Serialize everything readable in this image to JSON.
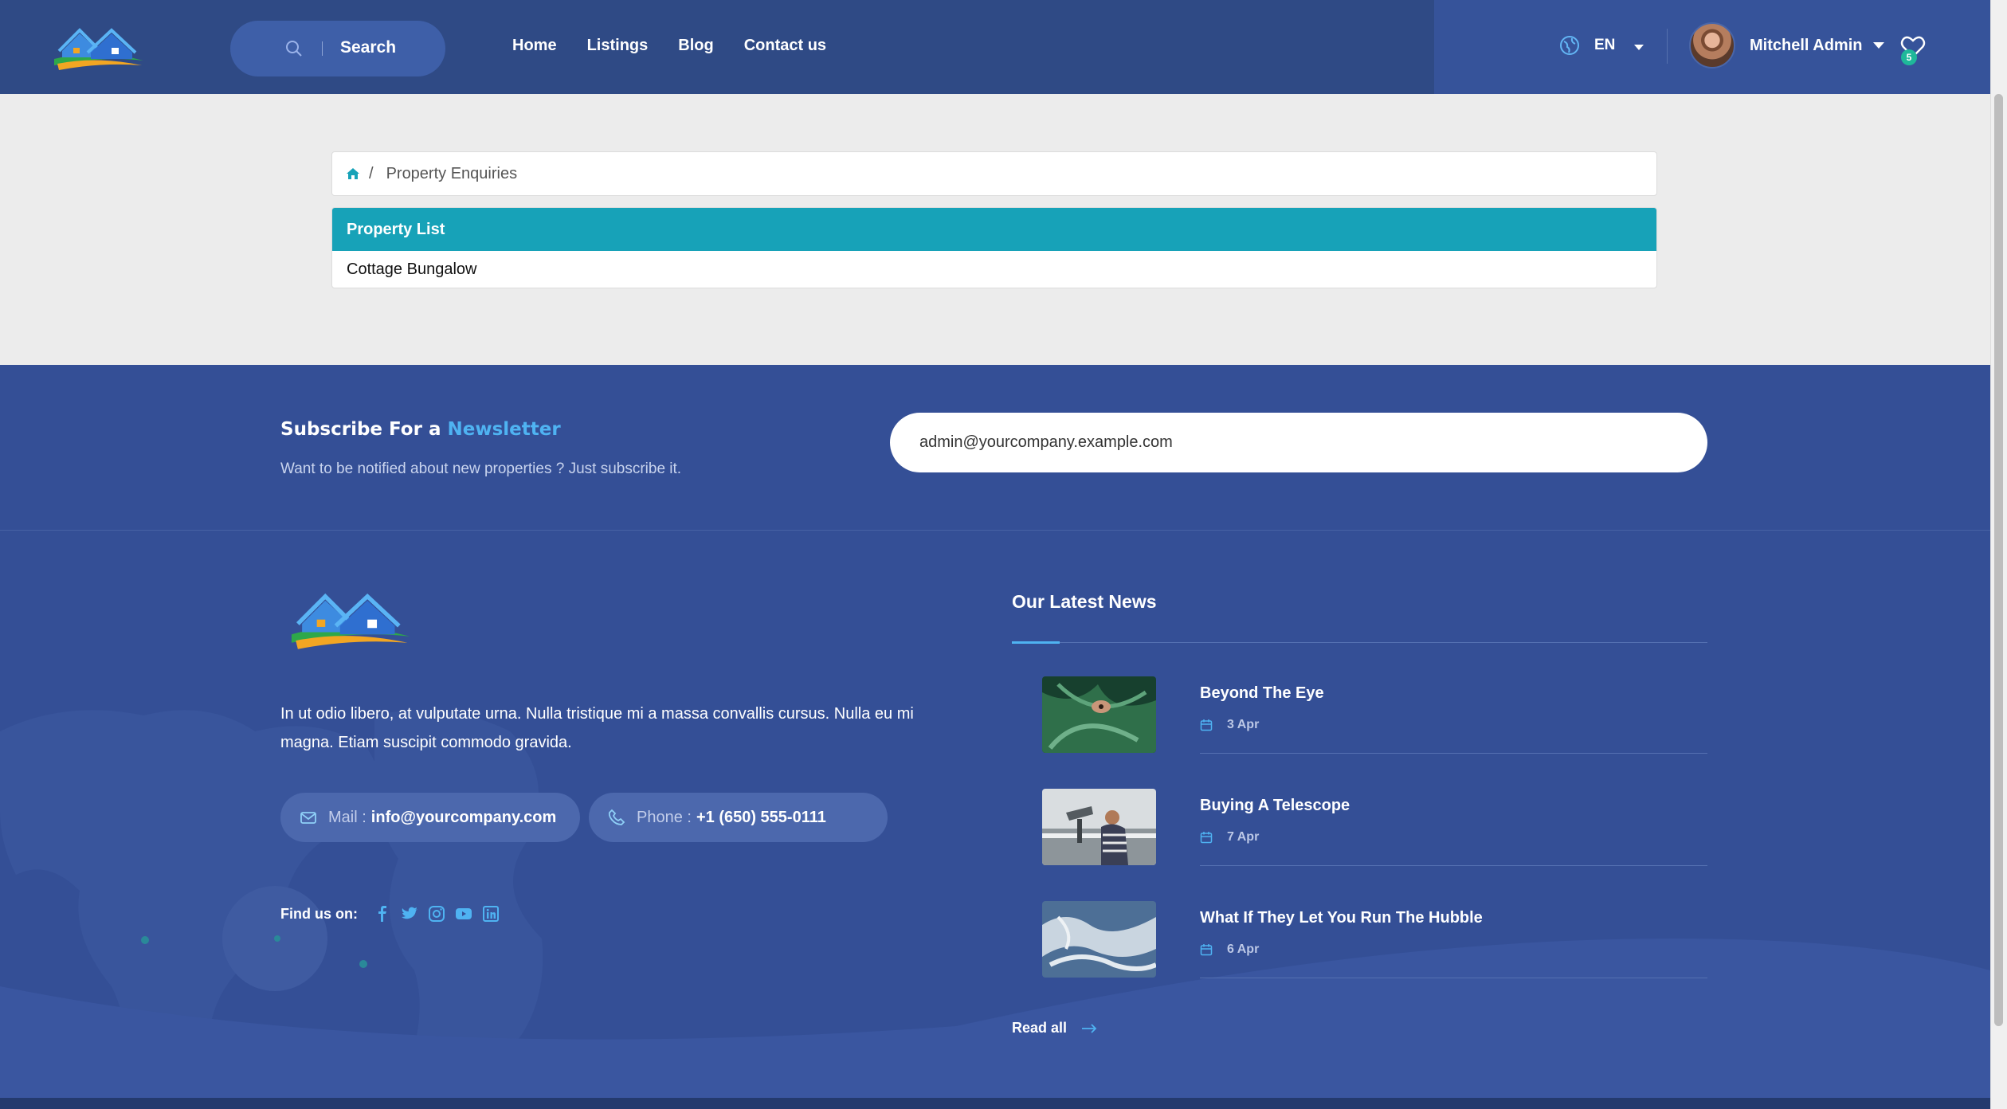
{
  "header": {
    "search_label": "Search",
    "nav": [
      {
        "label": "Home"
      },
      {
        "label": "Listings"
      },
      {
        "label": "Blog"
      },
      {
        "label": "Contact us"
      }
    ],
    "language": "EN",
    "user_name": "Mitchell Admin",
    "wishlist_count": "5",
    "icons": {
      "search": "search-icon",
      "globe": "globe-icon",
      "wishlist": "heart-icon"
    }
  },
  "breadcrumb": {
    "current": "Property Enquiries"
  },
  "property_list": {
    "title": "Property List",
    "items": [
      "Cottage Bungalow"
    ]
  },
  "newsletter": {
    "title_prefix": "Subscribe For a",
    "title_highlight": "Newsletter",
    "subtitle": "Want to be notified about new properties ? Just subscribe it.",
    "email_value": "admin@yourcompany.example.com"
  },
  "footer": {
    "about": "In ut odio libero, at vulputate urna. Nulla tristique mi a massa convallis cursus. Nulla eu mi magna. Etiam suscipit commodo gravida.",
    "mail_label": "Mail :",
    "mail_value": "info@yourcompany.com",
    "phone_label": "Phone :",
    "phone_value": "+1 (650) 555-0111",
    "find_us": "Find us on:",
    "social": [
      "facebook-icon",
      "twitter-icon",
      "instagram-icon",
      "youtube-icon",
      "linkedin-icon"
    ]
  },
  "news": {
    "title": "Our Latest News",
    "items": [
      {
        "title": "Beyond The Eye",
        "date": "3 Apr"
      },
      {
        "title": "Buying A Telescope",
        "date": "7 Apr"
      },
      {
        "title": "What If They Let You Run The Hubble",
        "date": "6 Apr"
      }
    ],
    "read_all": "Read all"
  },
  "colors": {
    "header_bg": "#2f4a85",
    "accent_teal": "#17a2b8",
    "footer_bg": "#344f96",
    "highlight_blue": "#4fb3f2",
    "badge_green": "#1fb89a"
  }
}
